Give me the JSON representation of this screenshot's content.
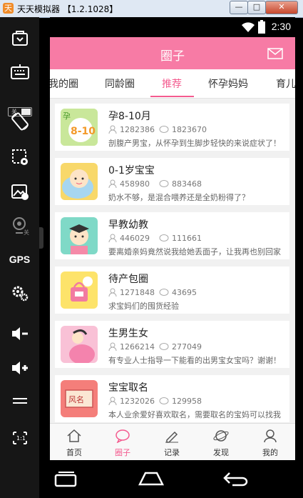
{
  "window": {
    "title": "天天模拟器 【1.2.1028】",
    "min_label": "—",
    "max_label": "□",
    "close_label": "✕"
  },
  "sidebar": {
    "toggle_label": "关",
    "gps_label": "GPS"
  },
  "status_bar": {
    "time": "2:30"
  },
  "app_bar": {
    "title": "圈子"
  },
  "tabs": [
    {
      "label": "我的圈"
    },
    {
      "label": "同龄圈"
    },
    {
      "label": "推荐"
    },
    {
      "label": "怀孕妈妈"
    },
    {
      "label": "育儿"
    }
  ],
  "active_tab": "推荐",
  "circles": [
    {
      "name": "孕8-10月",
      "members": "1282386",
      "posts": "1823670",
      "description": "剖腹产男宝，从怀孕到生脚步轻快的来说症状了！",
      "thumb_text": "8-10",
      "thumb_tag": "孕"
    },
    {
      "name": "0-1岁宝宝",
      "members": "458980",
      "posts": "883468",
      "description": "奶水不够，是混合喂养还是全奶粉得了？"
    },
    {
      "name": "早教幼教",
      "members": "446029",
      "posts": "111661",
      "description": "要离婚亲妈竟然说我给她丢面子，让我再也别回家"
    },
    {
      "name": "待产包圈",
      "members": "1271848",
      "posts": "43695",
      "description": "求宝妈们的囤货经验"
    },
    {
      "name": "生男生女",
      "members": "1266214",
      "posts": "277049",
      "description": "有专业人士指导一下能看的出男宝女宝吗？谢谢！"
    },
    {
      "name": "宝宝取名",
      "members": "1232026",
      "posts": "129958",
      "description": "本人业余爱好喜欢取名，需要取名的宝妈可以找我",
      "thumb_text": "风名"
    }
  ],
  "bottom_nav": [
    {
      "label": "首页",
      "icon": "home-icon"
    },
    {
      "label": "圈子",
      "icon": "circle-chat-icon"
    },
    {
      "label": "记录",
      "icon": "pencil-icon"
    },
    {
      "label": "发现",
      "icon": "planet-icon"
    },
    {
      "label": "我的",
      "icon": "profile-icon"
    }
  ],
  "active_nav": "圈子",
  "colors": {
    "brand_pink": "#f77ba5",
    "accent_pink": "#f45b8f"
  }
}
